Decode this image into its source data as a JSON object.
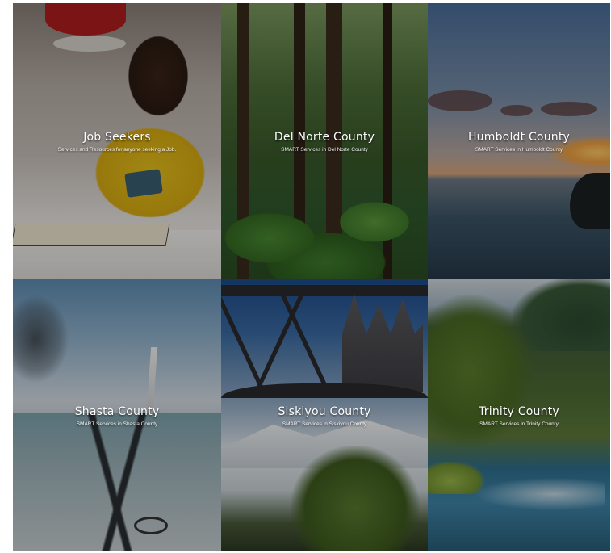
{
  "tiles": [
    {
      "title": "Job Seekers",
      "subtitle": "Services and Resources for anyone seeking a Job."
    },
    {
      "title": "Del Norte County",
      "subtitle": "SMART Services in Del Norte County"
    },
    {
      "title": "Humboldt County",
      "subtitle": "SMART Services in Humboldt County"
    },
    {
      "title": "Shasta County",
      "subtitle": "SMART Services in Shasta County"
    },
    {
      "title": "Siskiyou County",
      "subtitle": "SMART Services in Siskiyou County"
    },
    {
      "title": "Trinity County",
      "subtitle": "SMART Services in Trinity County"
    }
  ],
  "colors": {
    "caption_text": "#ffffff",
    "overlay": "rgba(0,0,0,0.30)"
  }
}
